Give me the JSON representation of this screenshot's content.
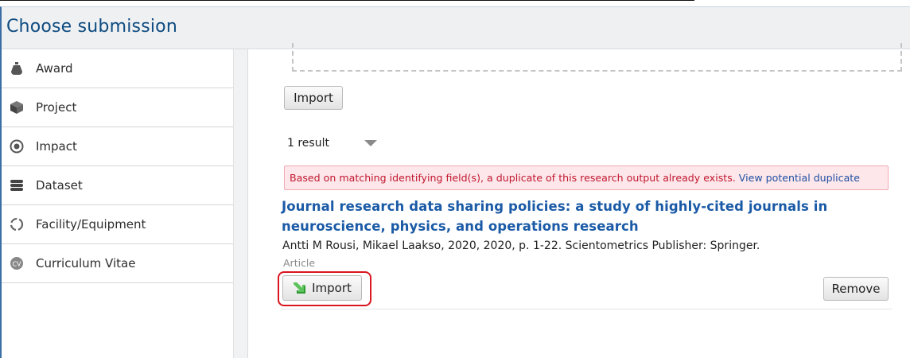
{
  "header": {
    "title": "Choose submission"
  },
  "sidebar": {
    "items": [
      {
        "label": "Award",
        "icon": "award-bag-icon"
      },
      {
        "label": "Project",
        "icon": "project-cube-icon"
      },
      {
        "label": "Impact",
        "icon": "impact-target-icon"
      },
      {
        "label": "Dataset",
        "icon": "dataset-stack-icon"
      },
      {
        "label": "Facility/Equipment",
        "icon": "facility-ring-icon"
      },
      {
        "label": "Curriculum Vitae",
        "icon": "cv-badge-icon"
      }
    ]
  },
  "main": {
    "top_import_label": "Import",
    "result_count": "1 result",
    "alert": {
      "message": "Based on matching identifying field(s), a duplicate of this research output already exists.",
      "link": "View potential duplicate"
    },
    "publication": {
      "title": "Journal research data sharing policies: a study of highly-cited journals in neuroscience, physics, and operations research",
      "meta": "Antti M Rousi, Mikael Laakso, 2020, 2020, p. 1-22. Scientometrics Publisher: Springer.",
      "type": "Article",
      "import_label": "Import",
      "remove_label": "Remove"
    }
  },
  "colors": {
    "header_title": "#0f4c81",
    "link": "#1a5aa6",
    "alert_text": "#c0172f",
    "highlight": "#d9161f"
  }
}
